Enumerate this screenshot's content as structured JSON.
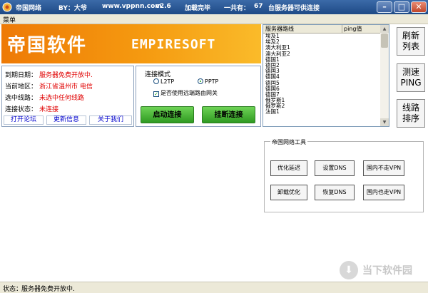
{
  "titlebar": {
    "app_name": "帝国网络",
    "by": "BY：大爷",
    "url": "www.vppnn.com",
    "version": "v2.6",
    "load_status": "加载完毕",
    "total_prefix": "一共有：",
    "server_count": "67",
    "total_suffix": "台服务器可供连接"
  },
  "menu": {
    "label": "菜单"
  },
  "banner": {
    "cn": "帝国软件",
    "en": "EMPIRESOFT"
  },
  "info": {
    "expiry_label": "到期日期：",
    "expiry_value": "服务器免费开放中.",
    "region_label": "当前地区：",
    "region_value": "浙江省温州市 电信",
    "line_label": "选中线路：",
    "line_value": "未选中任何线路",
    "status_label": "连接状态：",
    "status_value": "未连接",
    "links": [
      "打开论坛",
      "更新信息",
      "关于我们"
    ]
  },
  "connection": {
    "mode_label": "连接模式",
    "l2tp": "L2TP",
    "pptp": "PPTP",
    "selected_mode": "PPTP",
    "gateway_label": "是否使用远端路由网关",
    "gateway_checked": true,
    "start_button": "启动连接",
    "stop_button": "挂断连接"
  },
  "server_list": {
    "col_route": "服务器路线",
    "col_ping": "ping值",
    "rows": [
      "埃及1",
      "埃及2",
      "澳大利亚1",
      "澳大利亚2",
      "德国1",
      "德国2",
      "德国3",
      "德国4",
      "德国5",
      "德国6",
      "德国7",
      "俄罗斯1",
      "俄罗斯2",
      "法国1"
    ]
  },
  "side_buttons": {
    "refresh": [
      "刷新",
      "列表"
    ],
    "speedtest": [
      "测速",
      "PING"
    ],
    "sort": [
      "线路",
      "排序"
    ]
  },
  "tools": {
    "title": "帝国网络工具",
    "buttons": [
      "优化延迟",
      "设置DNS",
      "国内不走VPN",
      "卸载优化",
      "恢复DNS",
      "国内也走VPN"
    ]
  },
  "statusbar": {
    "label": "状态：",
    "value": "服务器免费开放中."
  },
  "watermark": {
    "text": "当下软件园"
  }
}
